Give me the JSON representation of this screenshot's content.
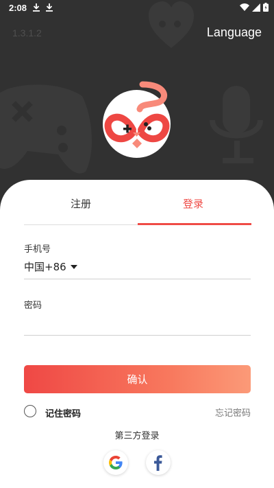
{
  "status_bar": {
    "time": "2:08",
    "icons": [
      "download-icon",
      "download-icon",
      "wifi-icon",
      "signal-icon",
      "battery-icon"
    ]
  },
  "header": {
    "version": "1.3.1.2",
    "language_label": "Language"
  },
  "logo": {
    "icon": "gamepad-cat-logo-icon"
  },
  "tabs": [
    {
      "label": "注册",
      "active": false
    },
    {
      "label": "登录",
      "active": true
    }
  ],
  "form": {
    "phone_label": "手机号",
    "country_code": "中国+86",
    "phone_value": "",
    "password_label": "密码",
    "password_value": "",
    "confirm_label": "确认"
  },
  "options": {
    "remember_label": "记住密码",
    "remember_checked": false,
    "forgot_label": "忘记密码"
  },
  "third_party": {
    "label": "第三方登录",
    "providers": [
      "google-icon",
      "facebook-icon"
    ]
  },
  "colors": {
    "accent": "#ef4b46",
    "background_dark": "#313131",
    "decoration": "#3b3b3b"
  }
}
